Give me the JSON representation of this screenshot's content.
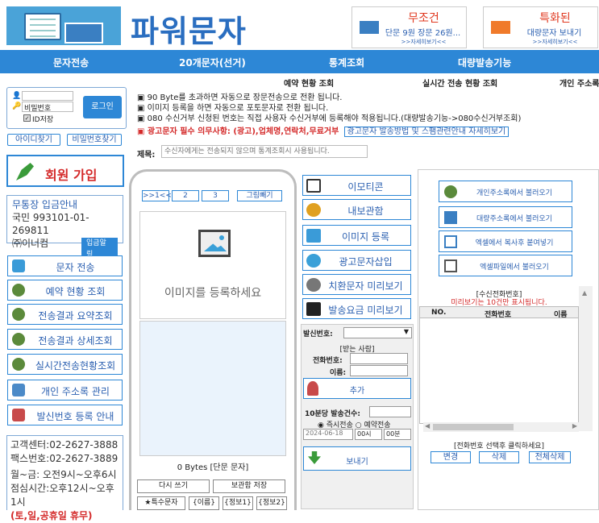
{
  "logo": {
    "text": "파워문자"
  },
  "promos": [
    {
      "title": "무조건",
      "sub": "단문 9원 장문 26원...",
      "link": ">>자세히보기<<"
    },
    {
      "title": "특화된",
      "sub": "대량문자 보내기",
      "link": ">>자세히보기<<"
    }
  ],
  "nav": [
    "문자전송",
    "20개문자(선거)",
    "통계조회",
    "대량발송기능"
  ],
  "subnav": [
    "예약 현황 조회",
    "실시간 전송 현황 조회",
    "개인 주소록"
  ],
  "login": {
    "password_label": "비밀번호",
    "save_id": "ID저장",
    "login_btn": "로그인",
    "find_id": "아이디찾기",
    "find_pw": "비밀번호찾기"
  },
  "notices": [
    "▣ 90 Byte를 초과하면 자동으로 장문전송으로 전환 됩니다.",
    "▣ 이미지 등록을 하면 자동으로 포토문자로 전환 됩니다.",
    "▣ 080 수신거부 신청된 번호는 직접 사용자 수신거부에 등록해야 적용됩니다.(대량발송기능->080수신거부조회)"
  ],
  "ad_notice": {
    "text": "▣ 광고문자 필수 의무사항: (광고),업체명,연락처,무료거부",
    "button": "광고문자 발송방법 및 스팸관련안내 자세히보기"
  },
  "subject": {
    "label": "제목:",
    "placeholder": "수신자에게는 전송되지 않으며 통계조회시 사용됩니다."
  },
  "join": {
    "label": "회원 가입"
  },
  "bank": {
    "line1": "무통장 입금안내",
    "line2": "국민 993101-01-269811",
    "line3": "㈜이너컴",
    "badge": "입금알림"
  },
  "side_menu": [
    "문자 전송",
    "예약 현황 조회",
    "전송결과 요약조회",
    "전송결과 상세조회",
    "실시간전송현황조회",
    "개인 주소록 관리",
    "발신번호 등록 안내"
  ],
  "contact": {
    "line1": "고객센터:02-2627-3888",
    "line2": "팩스번호:02-2627-3889",
    "line3": "월~금: 오전9시~오후6시",
    "line4": "점심시간:오후12시~오후1시",
    "line5": "(토,일,공휴일 휴무)"
  },
  "phone": {
    "pager": [
      ">>1<<",
      "2",
      "3"
    ],
    "img_btn": "그림빼기",
    "img_placeholder": "이미지를 등록하세요",
    "bytes": "0 Bytes  [단문 문자]",
    "draft": "다시 쓰기",
    "save": "보관함 저장",
    "special": "★특수문자",
    "name": "{이름}",
    "info1": "{정보1}",
    "info2": "{정보2}"
  },
  "middle_menu": [
    "이모티콘",
    "내보관함",
    "이미지 등록",
    "광고문자삽입",
    "치환문자 미리보기",
    "발송요금 미리보기"
  ],
  "send_panel": {
    "caller_label": "발신번호:",
    "recipient_title": "[받는 사람]",
    "phone_label": "전화번호:",
    "name_label": "이름:",
    "add_btn": "추가",
    "per10_label": "10분당 발송건수:",
    "immediate": "즉시전송",
    "reserve": "예약전송",
    "date": "2024-06-18",
    "hour": "00시",
    "minute": "00분",
    "send_btn": "보내기"
  },
  "right_buttons": [
    "개인주소록에서 불러오기",
    "대량주소록에서 불러오기",
    "엑셀에서 복사후 붙여넣기",
    "엑셀파일에서 불러오기"
  ],
  "recipient_list": {
    "title": "[수신전화번호]",
    "limit": "미리보기는 10건만 표시됩니다.",
    "col_no": "NO.",
    "col_phone": "전화번호",
    "col_name": "이름"
  },
  "bottom": {
    "hint": "[전화번호 선택후 클릭하세요]",
    "edit": "변경",
    "delete": "삭제",
    "delete_all": "전체삭제"
  },
  "colors": {
    "accent": "#2d87d6",
    "red": "#d42a2a"
  }
}
